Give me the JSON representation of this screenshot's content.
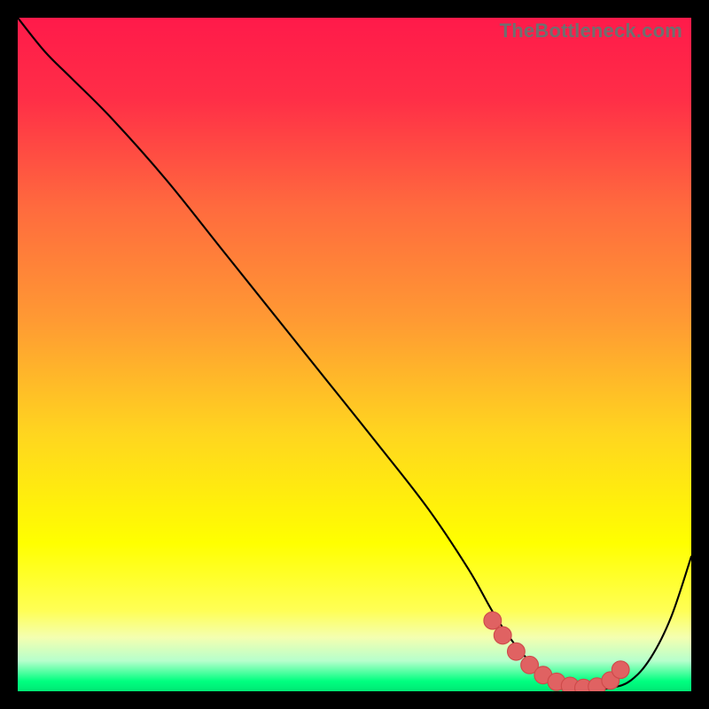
{
  "watermark": "TheBottleneck.com",
  "colors": {
    "gradient_stops": [
      {
        "offset": 0.0,
        "color": "#ff1a4a"
      },
      {
        "offset": 0.12,
        "color": "#ff2e47"
      },
      {
        "offset": 0.28,
        "color": "#ff6a3e"
      },
      {
        "offset": 0.45,
        "color": "#ff9a33"
      },
      {
        "offset": 0.62,
        "color": "#ffd61f"
      },
      {
        "offset": 0.78,
        "color": "#ffff00"
      },
      {
        "offset": 0.88,
        "color": "#ffff55"
      },
      {
        "offset": 0.92,
        "color": "#f4ffb0"
      },
      {
        "offset": 0.955,
        "color": "#b6ffcc"
      },
      {
        "offset": 0.985,
        "color": "#00ff80"
      },
      {
        "offset": 1.0,
        "color": "#00e874"
      }
    ],
    "curve_stroke": "#000000",
    "marker_fill": "#e06262",
    "marker_stroke": "#ce4a4a",
    "frame_bg": "#000000"
  },
  "chart_data": {
    "type": "line",
    "title": "",
    "xlabel": "",
    "ylabel": "",
    "xlim": [
      0,
      100
    ],
    "ylim": [
      0,
      100
    ],
    "series": [
      {
        "name": "bottleneck-curve",
        "x": [
          0,
          4,
          8,
          14,
          22,
          30,
          38,
          46,
          54,
          61,
          67,
          71,
          75,
          79,
          82,
          85,
          88,
          91,
          94,
          97,
          100
        ],
        "y": [
          100,
          95,
          91,
          85,
          76,
          66,
          56,
          46,
          36,
          27,
          18,
          11,
          5.5,
          2.0,
          0.7,
          0.3,
          0.5,
          1.6,
          5.0,
          11,
          20
        ]
      }
    ],
    "markers": {
      "name": "highlight-dots",
      "x": [
        70.5,
        72,
        74,
        76,
        78,
        80,
        82,
        84,
        86,
        88,
        89.5
      ],
      "y": [
        10.5,
        8.3,
        5.9,
        3.9,
        2.4,
        1.4,
        0.8,
        0.5,
        0.7,
        1.6,
        3.2
      ]
    }
  }
}
